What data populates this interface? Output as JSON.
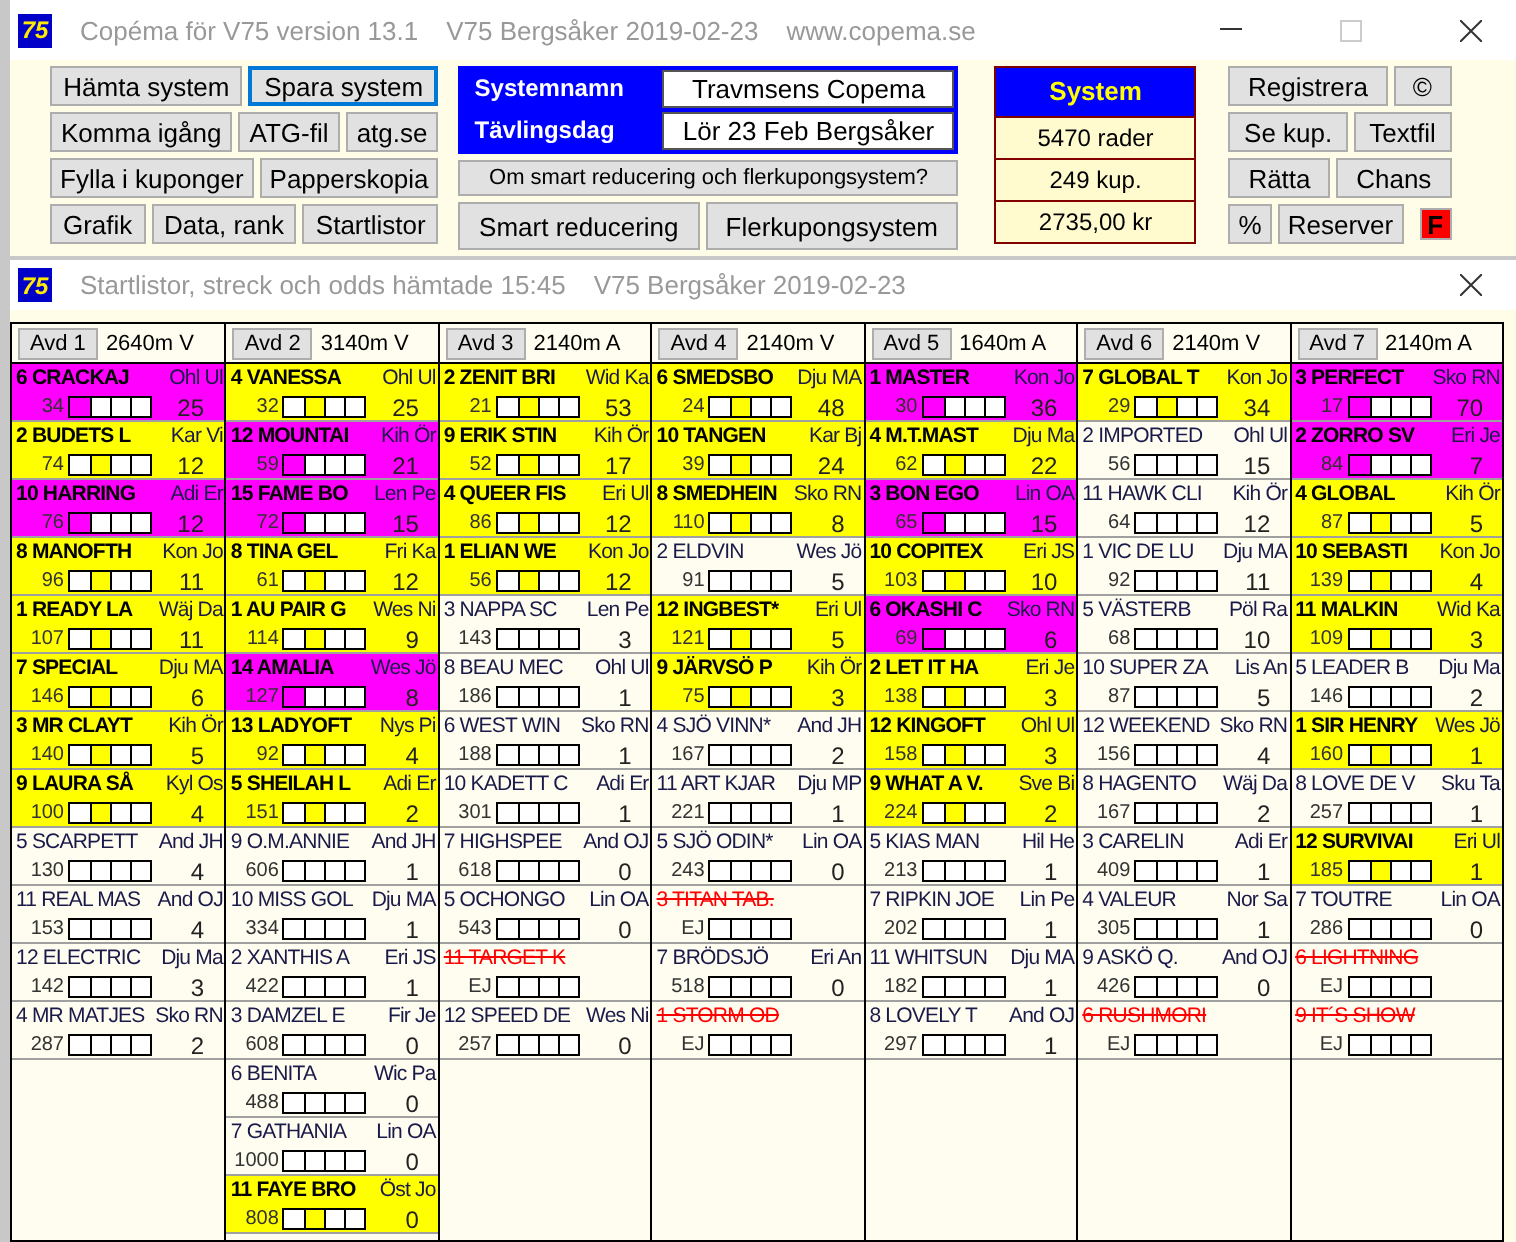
{
  "window": {
    "logo": "75",
    "title": "Copéma för V75 version 13.1",
    "subtitle": "V75 Bergsåker 2019-02-23",
    "website": "www.copema.se"
  },
  "toolbar": {
    "left_buttons": [
      [
        {
          "label": "Hämta system",
          "focused": false
        },
        {
          "label": "Spara system",
          "focused": true
        }
      ],
      [
        {
          "label": "Komma igång",
          "focused": false
        },
        {
          "label": "ATG-fil",
          "focused": false
        },
        {
          "label": "atg.se",
          "focused": false
        }
      ],
      [
        {
          "label": "Fylla i kuponger",
          "focused": false
        },
        {
          "label": "Papperskopia",
          "focused": false
        }
      ],
      [
        {
          "label": "Grafik",
          "focused": false
        },
        {
          "label": "Data, rank",
          "focused": false
        },
        {
          "label": "Startlistor",
          "focused": false
        }
      ]
    ],
    "system_info": [
      {
        "label": "Systemnamn",
        "value": "Travmsens Copema"
      },
      {
        "label": "Tävlingsdag",
        "value": "Lör 23 Feb Bergsåker"
      }
    ],
    "info_button": "Om smart reducering och flerkupongsystem?",
    "mode_buttons": [
      "Smart reducering",
      "Flerkupongsystem"
    ],
    "system_summary": {
      "title": "System",
      "rows": [
        "5470 rader",
        "249 kup.",
        "2735,00 kr"
      ]
    },
    "right_buttons": [
      [
        {
          "label": "Registrera",
          "kind": "normal"
        },
        {
          "label": "©",
          "kind": "normal"
        }
      ],
      [
        {
          "label": "Se kup.",
          "kind": "normal"
        },
        {
          "label": "Textfil",
          "kind": "normal"
        }
      ],
      [
        {
          "label": "Rätta",
          "kind": "normal"
        },
        {
          "label": "Chans",
          "kind": "normal"
        }
      ],
      [
        {
          "label": "%",
          "kind": "normal"
        },
        {
          "label": "Reserver",
          "kind": "normal"
        },
        {
          "label": "F",
          "kind": "alert"
        }
      ]
    ]
  },
  "startlist_window": {
    "logo": "75",
    "title": "Startlistor, streck och odds hämtade 15:45",
    "subtitle": "V75 Bergsåker 2019-02-23"
  },
  "races": [
    {
      "label": "Avd 1",
      "distance": "2640m V",
      "horses": [
        {
          "kind": "spik",
          "name": "6 CRACKAJ",
          "driver": "Ohl Ul",
          "rank": "34",
          "odds": "25"
        },
        {
          "kind": "pick",
          "name": "2 BUDETS L",
          "driver": "Kar Vi",
          "rank": "74",
          "odds": "12"
        },
        {
          "kind": "spik",
          "name": "10 HARRING",
          "driver": "Adi Er",
          "rank": "76",
          "odds": "12"
        },
        {
          "kind": "pick",
          "name": "8 MANOFTH",
          "driver": "Kon Jo",
          "rank": "96",
          "odds": "11"
        },
        {
          "kind": "pick",
          "name": "1 READY LA",
          "driver": "Wäj Da",
          "rank": "107",
          "odds": "11"
        },
        {
          "kind": "pick",
          "name": "7 SPECIAL",
          "driver": "Dju MA",
          "rank": "146",
          "odds": "6"
        },
        {
          "kind": "pick",
          "name": "3 MR CLAYT",
          "driver": "Kih Ör",
          "rank": "140",
          "odds": "5"
        },
        {
          "kind": "pick",
          "name": "9 LAURA SÅ",
          "driver": "Kyl Os",
          "rank": "100",
          "odds": "4"
        },
        {
          "kind": "plain",
          "name": "5 SCARPETT",
          "driver": "And JH",
          "rank": "130",
          "odds": "4"
        },
        {
          "kind": "plain",
          "name": "11 REAL MAS",
          "driver": "And OJ",
          "rank": "153",
          "odds": "4"
        },
        {
          "kind": "plain",
          "name": "12 ELECTRIC",
          "driver": "Dju Ma",
          "rank": "142",
          "odds": "3"
        },
        {
          "kind": "plain",
          "name": "4 MR MATJES",
          "driver": "Sko RN",
          "rank": "287",
          "odds": "2"
        }
      ]
    },
    {
      "label": "Avd 2",
      "distance": "3140m V",
      "horses": [
        {
          "kind": "pick",
          "name": "4 VANESSA",
          "driver": "Ohl Ul",
          "rank": "32",
          "odds": "25"
        },
        {
          "kind": "spik",
          "name": "12 MOUNTAI",
          "driver": "Kih Ör",
          "rank": "59",
          "odds": "21"
        },
        {
          "kind": "spik",
          "name": "15 FAME BO",
          "driver": "Len Pe",
          "rank": "72",
          "odds": "15"
        },
        {
          "kind": "pick",
          "name": "8 TINA GEL",
          "driver": "Fri Ka",
          "rank": "61",
          "odds": "12"
        },
        {
          "kind": "pick",
          "name": "1 AU PAIR G",
          "driver": "Wes Ni",
          "rank": "114",
          "odds": "9"
        },
        {
          "kind": "spik",
          "name": "14 AMALIA",
          "driver": "Wes Jö",
          "rank": "127",
          "odds": "8"
        },
        {
          "kind": "pick",
          "name": "13 LADYOFT",
          "driver": "Nys Pi",
          "rank": "92",
          "odds": "4"
        },
        {
          "kind": "pick",
          "name": "5 SHEILAH L",
          "driver": "Adi Er",
          "rank": "151",
          "odds": "2"
        },
        {
          "kind": "plain",
          "name": "9 O.M.ANNIE",
          "driver": "And JH",
          "rank": "606",
          "odds": "1"
        },
        {
          "kind": "plain",
          "name": "10 MISS GOL",
          "driver": "Dju MA",
          "rank": "334",
          "odds": "1"
        },
        {
          "kind": "plain",
          "name": "2 XANTHIS A",
          "driver": "Eri JS",
          "rank": "422",
          "odds": "1"
        },
        {
          "kind": "plain",
          "name": "3 DAMZEL E",
          "driver": "Fir Je",
          "rank": "608",
          "odds": "0"
        },
        {
          "kind": "plain",
          "name": "6 BENITA",
          "driver": "Wic Pa",
          "rank": "488",
          "odds": "0"
        },
        {
          "kind": "plain",
          "name": "7 GATHANIA",
          "driver": "Lin OA",
          "rank": "1000",
          "odds": "0"
        },
        {
          "kind": "pick",
          "name": "11 FAYE BRO",
          "driver": "Öst Jo",
          "rank": "808",
          "odds": "0"
        }
      ]
    },
    {
      "label": "Avd 3",
      "distance": "2140m A",
      "horses": [
        {
          "kind": "pick",
          "name": "2 ZENIT BRI",
          "driver": "Wid Ka",
          "rank": "21",
          "odds": "53"
        },
        {
          "kind": "pick",
          "name": "9 ERIK STIN",
          "driver": "Kih Ör",
          "rank": "52",
          "odds": "17"
        },
        {
          "kind": "pick",
          "name": "4 QUEER FIS",
          "driver": "Eri Ul",
          "rank": "86",
          "odds": "12"
        },
        {
          "kind": "pick",
          "name": "1 ELIAN WE",
          "driver": "Kon Jo",
          "rank": "56",
          "odds": "12"
        },
        {
          "kind": "plain",
          "name": "3 NAPPA SC",
          "driver": "Len Pe",
          "rank": "143",
          "odds": "3"
        },
        {
          "kind": "plain",
          "name": "8 BEAU MEC",
          "driver": "Ohl Ul",
          "rank": "186",
          "odds": "1"
        },
        {
          "kind": "plain",
          "name": "6 WEST WIN",
          "driver": "Sko RN",
          "rank": "188",
          "odds": "1"
        },
        {
          "kind": "plain",
          "name": "10 KADETT C",
          "driver": "Adi Er",
          "rank": "301",
          "odds": "1"
        },
        {
          "kind": "plain",
          "name": "7 HIGHSPEE",
          "driver": "And OJ",
          "rank": "618",
          "odds": "0"
        },
        {
          "kind": "plain",
          "name": "5 OCHONGO",
          "driver": "Lin OA",
          "rank": "543",
          "odds": "0"
        },
        {
          "kind": "scratched",
          "name": "11 TARGET K",
          "rank": "EJ"
        },
        {
          "kind": "plain",
          "name": "12 SPEED DE",
          "driver": "Wes Ni",
          "rank": "257",
          "odds": "0"
        }
      ]
    },
    {
      "label": "Avd 4",
      "distance": "2140m V",
      "horses": [
        {
          "kind": "pick",
          "name": "6 SMEDSBO",
          "driver": "Dju MA",
          "rank": "24",
          "odds": "48"
        },
        {
          "kind": "pick",
          "name": "10 TANGEN",
          "driver": "Kar Bj",
          "rank": "39",
          "odds": "24"
        },
        {
          "kind": "pick",
          "name": "8 SMEDHEIN",
          "driver": "Sko RN",
          "rank": "110",
          "odds": "8"
        },
        {
          "kind": "plain",
          "name": "2 ELDVIN",
          "driver": "Wes Jö",
          "rank": "91",
          "odds": "5"
        },
        {
          "kind": "pick",
          "name": "12 INGBEST*",
          "driver": "Eri Ul",
          "rank": "121",
          "odds": "5"
        },
        {
          "kind": "pick",
          "name": "9 JÄRVSÖ P",
          "driver": "Kih Ör",
          "rank": "75",
          "odds": "3"
        },
        {
          "kind": "plain",
          "name": "4 SJÖ VINN*",
          "driver": "And JH",
          "rank": "167",
          "odds": "2"
        },
        {
          "kind": "plain",
          "name": "11 ART KJAR",
          "driver": "Dju MP",
          "rank": "221",
          "odds": "1"
        },
        {
          "kind": "plain",
          "name": "5 SJÖ ODIN*",
          "driver": "Lin OA",
          "rank": "243",
          "odds": "0"
        },
        {
          "kind": "scratched",
          "name": "3 TITAN TAB.",
          "rank": "EJ"
        },
        {
          "kind": "plain",
          "name": "7 BRÖDSJÖ",
          "driver": "Eri An",
          "rank": "518",
          "odds": "0"
        },
        {
          "kind": "scratched",
          "name": "1 STORM OD",
          "rank": "EJ"
        }
      ]
    },
    {
      "label": "Avd 5",
      "distance": "1640m A",
      "horses": [
        {
          "kind": "spik",
          "name": "1 MASTER",
          "driver": "Kon Jo",
          "rank": "30",
          "odds": "36"
        },
        {
          "kind": "pick",
          "name": "4 M.T.MAST",
          "driver": "Dju Ma",
          "rank": "62",
          "odds": "22"
        },
        {
          "kind": "spik",
          "name": "3 BON EGO",
          "driver": "Lin OA",
          "rank": "65",
          "odds": "15"
        },
        {
          "kind": "pick",
          "name": "10 COPITEX",
          "driver": "Eri JS",
          "rank": "103",
          "odds": "10"
        },
        {
          "kind": "spik",
          "name": "6 OKASHI C",
          "driver": "Sko RN",
          "rank": "69",
          "odds": "6"
        },
        {
          "kind": "pick",
          "name": "2 LET IT HA",
          "driver": "Eri Je",
          "rank": "138",
          "odds": "3"
        },
        {
          "kind": "pick",
          "name": "12 KINGOFT",
          "driver": "Ohl Ul",
          "rank": "158",
          "odds": "3"
        },
        {
          "kind": "pick",
          "name": "9 WHAT A V.",
          "driver": "Sve Bi",
          "rank": "224",
          "odds": "2"
        },
        {
          "kind": "plain",
          "name": "5 KIAS MAN",
          "driver": "Hil He",
          "rank": "213",
          "odds": "1"
        },
        {
          "kind": "plain",
          "name": "7 RIPKIN JOE",
          "driver": "Lin Pe",
          "rank": "202",
          "odds": "1"
        },
        {
          "kind": "plain",
          "name": "11 WHITSUN",
          "driver": "Dju MA",
          "rank": "182",
          "odds": "1"
        },
        {
          "kind": "plain",
          "name": "8 LOVELY T",
          "driver": "And OJ",
          "rank": "297",
          "odds": "1"
        }
      ]
    },
    {
      "label": "Avd 6",
      "distance": "2140m V",
      "horses": [
        {
          "kind": "pick",
          "name": "7 GLOBAL T",
          "driver": "Kon Jo",
          "rank": "29",
          "odds": "34"
        },
        {
          "kind": "plain",
          "name": "2 IMPORTED",
          "driver": "Ohl Ul",
          "rank": "56",
          "odds": "15"
        },
        {
          "kind": "plain",
          "name": "11 HAWK CLI",
          "driver": "Kih Ör",
          "rank": "64",
          "odds": "12"
        },
        {
          "kind": "plain",
          "name": "1 VIC DE LU",
          "driver": "Dju MA",
          "rank": "92",
          "odds": "11"
        },
        {
          "kind": "plain",
          "name": "5 VÄSTERB",
          "driver": "Pöl Ra",
          "rank": "68",
          "odds": "10"
        },
        {
          "kind": "plain",
          "name": "10 SUPER ZA",
          "driver": "Lis An",
          "rank": "87",
          "odds": "5"
        },
        {
          "kind": "plain",
          "name": "12 WEEKEND",
          "driver": "Sko RN",
          "rank": "156",
          "odds": "4"
        },
        {
          "kind": "plain",
          "name": "8 HAGENTO",
          "driver": "Wäj Da",
          "rank": "167",
          "odds": "2"
        },
        {
          "kind": "plain",
          "name": "3 CARELIN",
          "driver": "Adi Er",
          "rank": "409",
          "odds": "1"
        },
        {
          "kind": "plain",
          "name": "4 VALEUR",
          "driver": "Nor Sa",
          "rank": "305",
          "odds": "1"
        },
        {
          "kind": "plain",
          "name": "9 ASKÖ Q.",
          "driver": "And OJ",
          "rank": "426",
          "odds": "0"
        },
        {
          "kind": "scratched",
          "name": "6 RUSHMORI",
          "rank": "EJ"
        }
      ]
    },
    {
      "label": "Avd 7",
      "distance": "2140m A",
      "horses": [
        {
          "kind": "spik",
          "name": "3 PERFECT",
          "driver": "Sko RN",
          "rank": "17",
          "odds": "70"
        },
        {
          "kind": "spik",
          "name": "2 ZORRO SV",
          "driver": "Eri Je",
          "rank": "84",
          "odds": "7"
        },
        {
          "kind": "pick",
          "name": "4 GLOBAL",
          "driver": "Kih Ör",
          "rank": "87",
          "odds": "5"
        },
        {
          "kind": "pick",
          "name": "10 SEBASTI",
          "driver": "Kon Jo",
          "rank": "139",
          "odds": "4"
        },
        {
          "kind": "pick",
          "name": "11 MALKIN",
          "driver": "Wid Ka",
          "rank": "109",
          "odds": "3"
        },
        {
          "kind": "plain",
          "name": "5 LEADER B",
          "driver": "Dju Ma",
          "rank": "146",
          "odds": "2"
        },
        {
          "kind": "pick",
          "name": "1 SIR HENRY",
          "driver": "Wes Jö",
          "rank": "160",
          "odds": "1"
        },
        {
          "kind": "plain",
          "name": "8 LOVE DE V",
          "driver": "Sku Ta",
          "rank": "257",
          "odds": "1"
        },
        {
          "kind": "pick",
          "name": "12 SURVIVAI",
          "driver": "Eri Ul",
          "rank": "185",
          "odds": "1"
        },
        {
          "kind": "plain",
          "name": "7 TOUTRE",
          "driver": "Lin OA",
          "rank": "286",
          "odds": "0"
        },
        {
          "kind": "scratched",
          "name": "6 LIGHTNING",
          "rank": "EJ"
        },
        {
          "kind": "scratched",
          "name": "9 IT´S SHOW",
          "rank": "EJ"
        }
      ]
    }
  ]
}
